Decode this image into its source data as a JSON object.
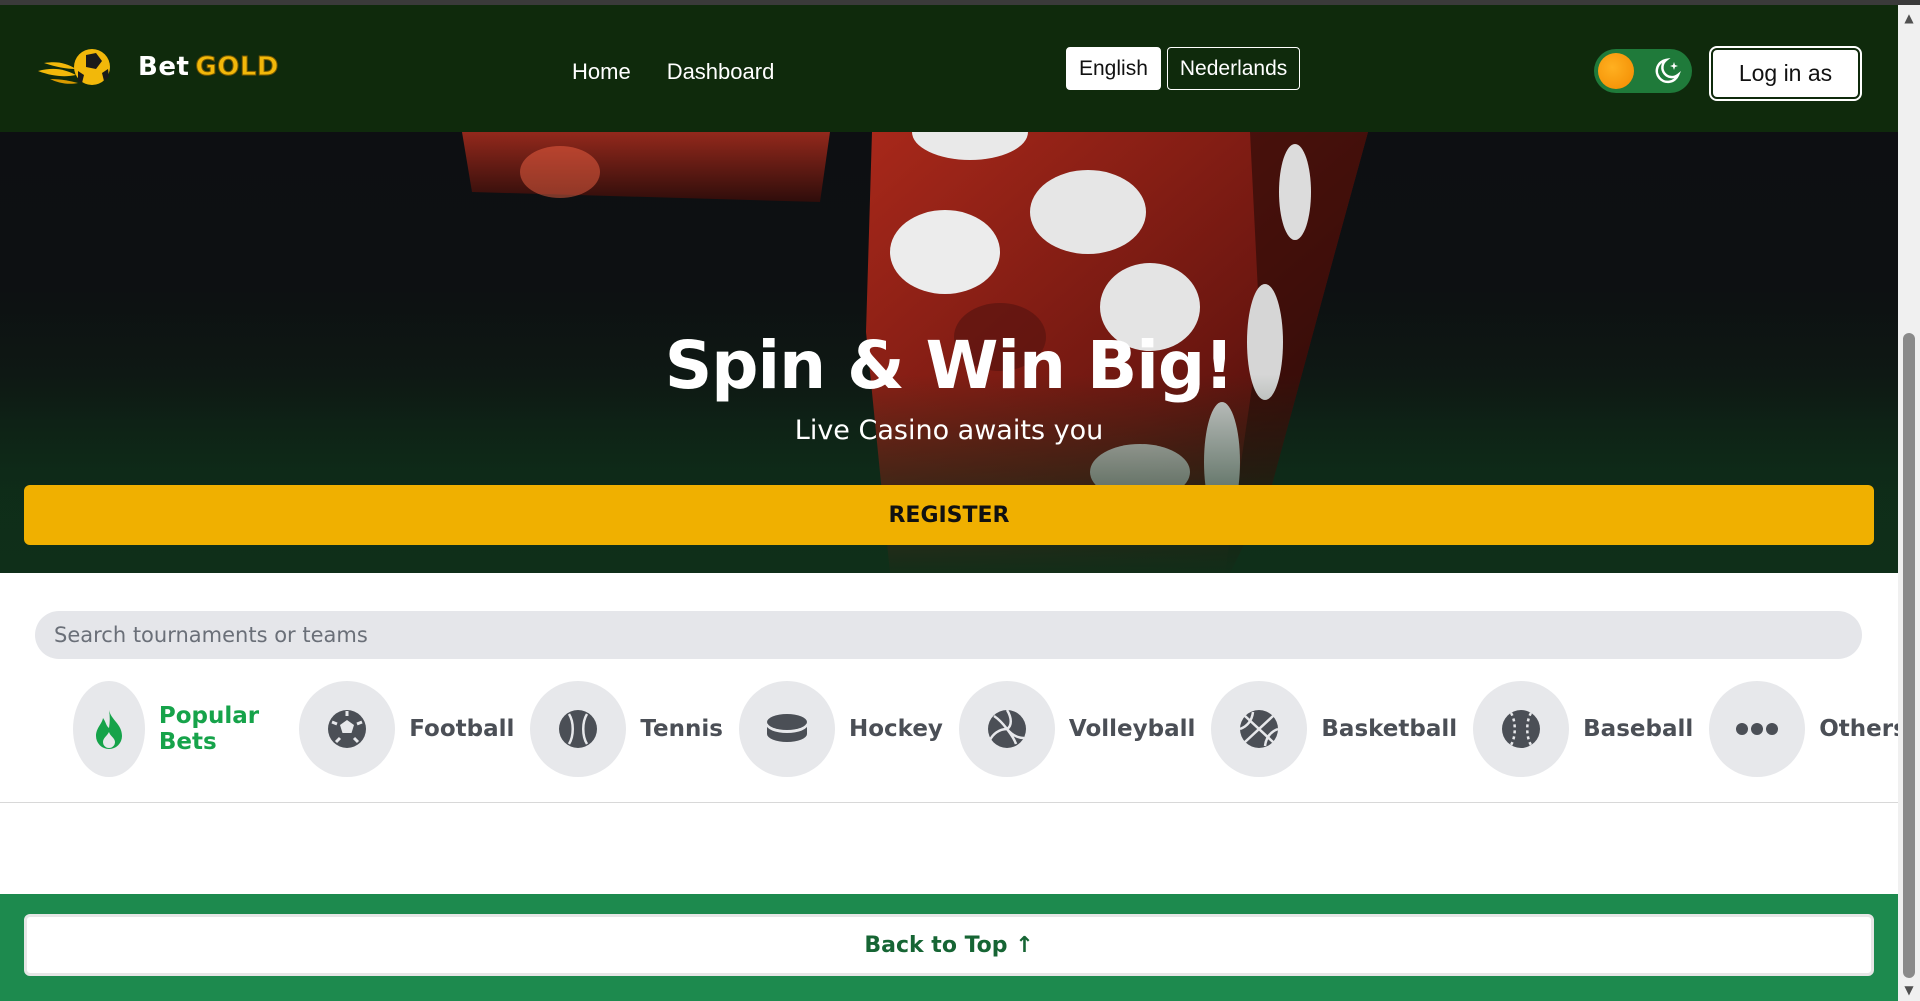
{
  "header": {
    "logo_bet": "Bet",
    "logo_gold": "GOLD",
    "nav": [
      {
        "label": "Home"
      },
      {
        "label": "Dashboard"
      }
    ],
    "languages": [
      {
        "label": "English",
        "active": true
      },
      {
        "label": "Nederlands",
        "active": false
      }
    ],
    "login_label": "Log in as"
  },
  "hero": {
    "title": "Spin & Win Big!",
    "subtitle": "Live Casino awaits you",
    "register_label": "REGISTER"
  },
  "search": {
    "placeholder": "Search tournaments or teams"
  },
  "categories": [
    {
      "label": "Popular Bets",
      "icon": "flame-icon",
      "active": true
    },
    {
      "label": "Football",
      "icon": "football-icon",
      "active": false
    },
    {
      "label": "Tennis",
      "icon": "tennis-ball-icon",
      "active": false
    },
    {
      "label": "Hockey",
      "icon": "hockey-puck-icon",
      "active": false
    },
    {
      "label": "Volleyball",
      "icon": "volleyball-icon",
      "active": false
    },
    {
      "label": "Basketball",
      "icon": "basketball-icon",
      "active": false
    },
    {
      "label": "Baseball",
      "icon": "baseball-icon",
      "active": false
    },
    {
      "label": "Others",
      "icon": "more-dots-icon",
      "active": false
    }
  ],
  "footer": {
    "back_to_top_label": "Back to Top ↑"
  },
  "colors": {
    "header_bg": "#0f2a0c",
    "accent_gold": "#f0b000",
    "active_green": "#16a34a",
    "footer_green": "#1d8a4e"
  }
}
